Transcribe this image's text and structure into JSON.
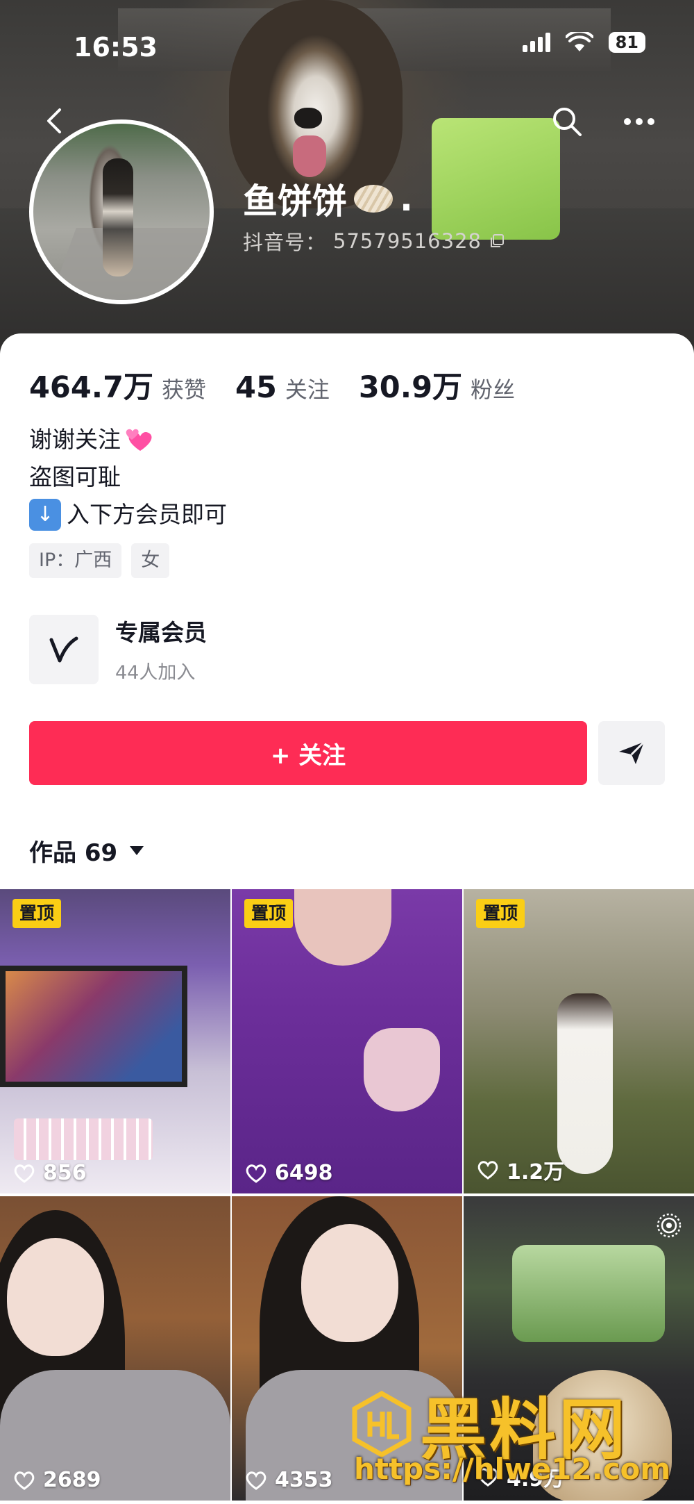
{
  "status_bar": {
    "time": "16:53",
    "battery": "81"
  },
  "profile": {
    "nickname": "鱼饼饼",
    "nickname_suffix": ".",
    "douyin_id_label": "抖音号：",
    "douyin_id": "57579516328"
  },
  "stats": [
    {
      "value": "464.7万",
      "label": "获赞"
    },
    {
      "value": "45",
      "label": "关注"
    },
    {
      "value": "30.9万",
      "label": "粉丝"
    }
  ],
  "bio": {
    "line1": "谢谢关注",
    "line2": "盗图可耻",
    "line3": "入下方会员即可"
  },
  "tags": {
    "ip": "IP：广西",
    "gender": "女"
  },
  "member": {
    "title": "专属会员",
    "subtitle": "44人加入"
  },
  "actions": {
    "follow_label": "+ 关注"
  },
  "works": {
    "label": "作品 69"
  },
  "grid": [
    {
      "pinned": "置顶",
      "likes": "856"
    },
    {
      "pinned": "置顶",
      "likes": "6498"
    },
    {
      "pinned": "置顶",
      "likes": "1.2万"
    },
    {
      "pinned": "",
      "likes": "2689"
    },
    {
      "pinned": "",
      "likes": "4353"
    },
    {
      "pinned": "",
      "likes": "4.9万"
    }
  ],
  "watermark": {
    "title": "黑料网",
    "url": "https://hlwe12.com"
  },
  "icons": [
    "back-icon",
    "search-icon",
    "more-icon",
    "copy-icon",
    "member-logo-icon",
    "share-icon",
    "heart-icon",
    "live-photo-icon"
  ],
  "colors": {
    "follow_button": "#fe2c55",
    "pin_badge": "#face15",
    "watermark": "#f6c12a"
  }
}
